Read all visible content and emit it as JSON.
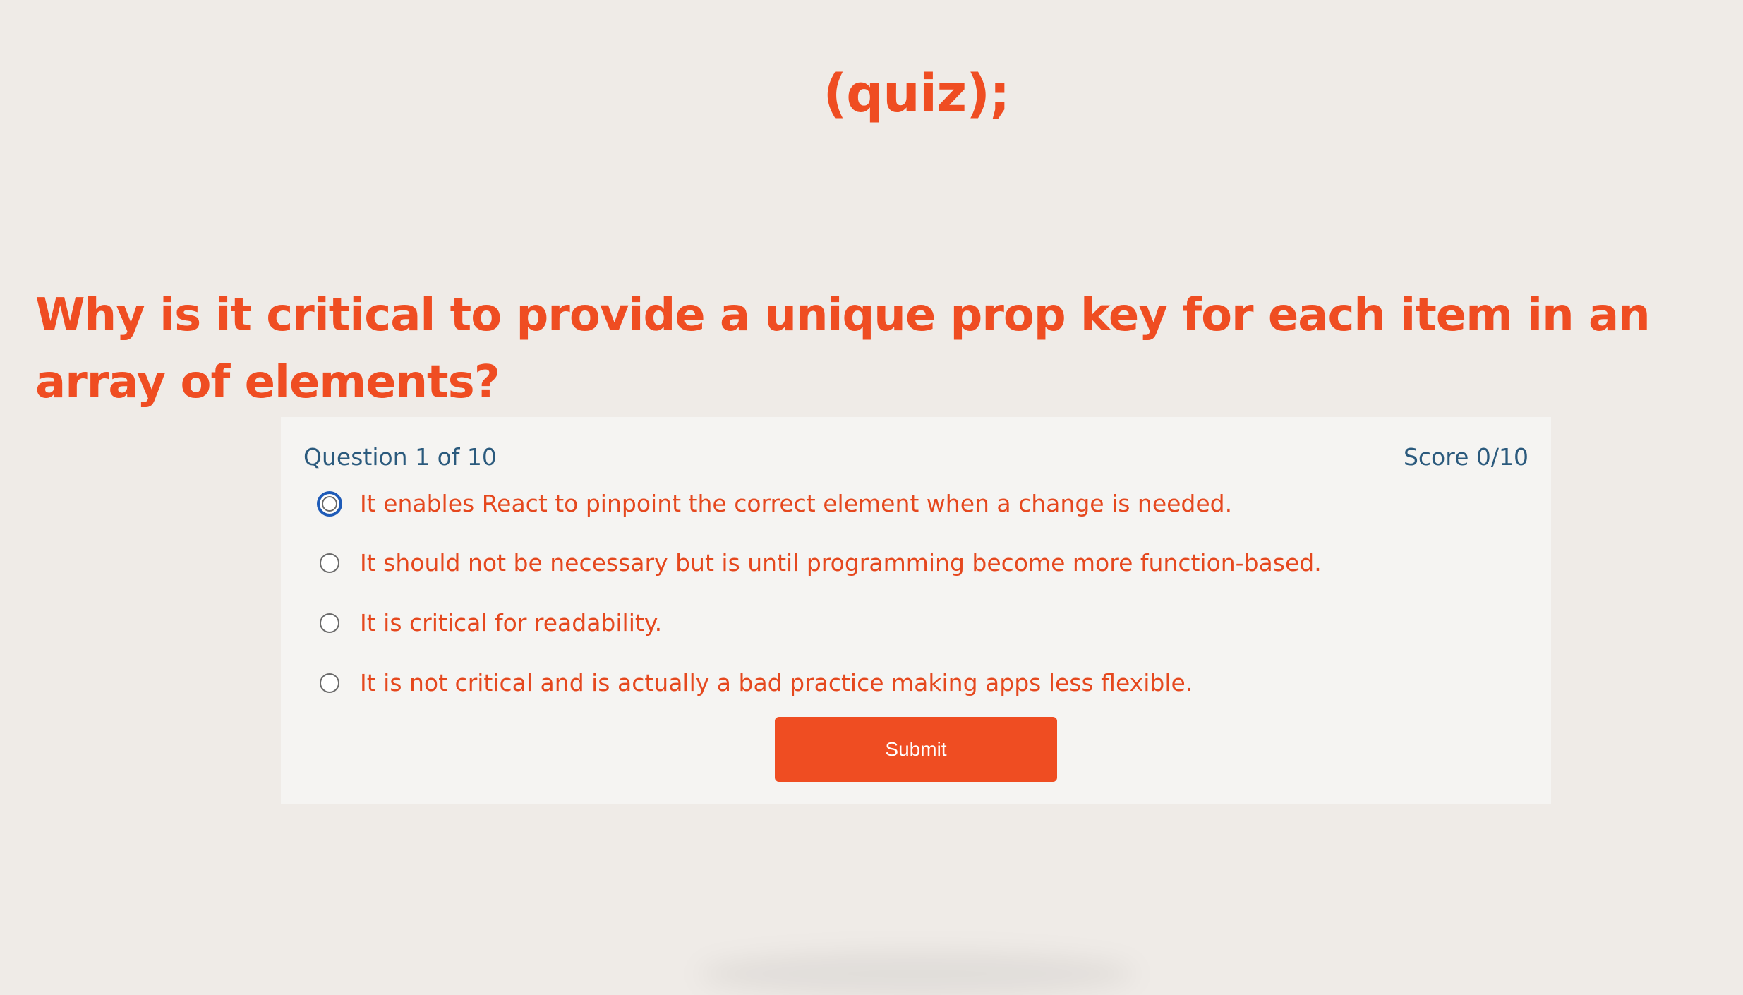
{
  "header": {
    "logo_text": "(quiz);"
  },
  "question": {
    "text": "Why is it critical to provide a unique prop key for each item in an array of elements?"
  },
  "progress": {
    "question_label": "Question 1 of 10",
    "score_label": "Score 0/10"
  },
  "options": [
    {
      "label": "It enables React to pinpoint the correct element when a change is needed."
    },
    {
      "label": "It should not be necessary but is until programming become more function-based."
    },
    {
      "label": "It is critical for readability."
    },
    {
      "label": "It is not critical and is actually a bad practice making apps less flexible."
    }
  ],
  "submit": {
    "label": "Submit"
  },
  "colors": {
    "accent": "#ef4d22",
    "background": "#efebe7",
    "card": "#f5f4f2",
    "meta_text": "#2b5a7d",
    "focus_ring": "#1e5bb8"
  }
}
